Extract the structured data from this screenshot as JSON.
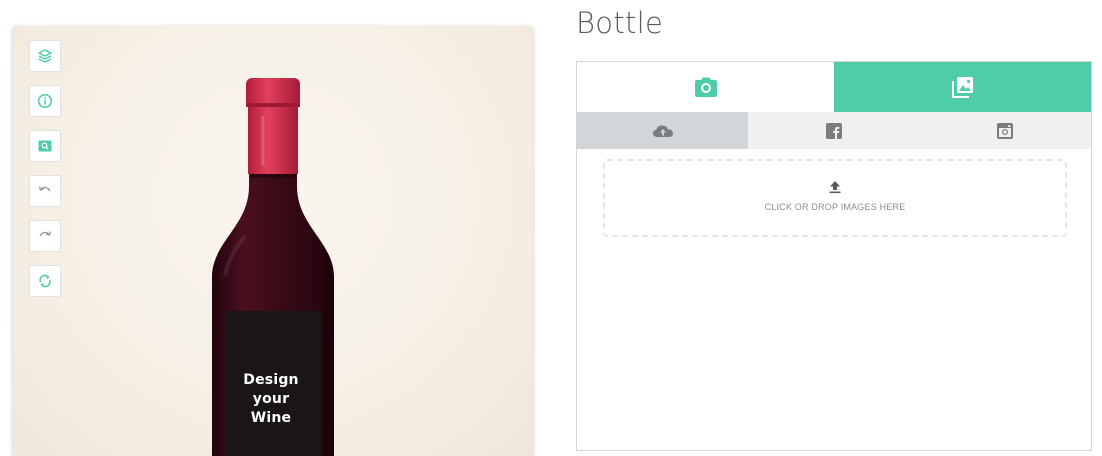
{
  "product": {
    "label_lines": [
      "Design",
      "your",
      "Wine"
    ],
    "bottle_capsule_color": "#d8324f",
    "bottle_glass_color": "#3c0a17"
  },
  "toolbar": {
    "items": [
      {
        "icon": "layers-icon",
        "name": "layers-button"
      },
      {
        "icon": "info-icon",
        "name": "info-button"
      },
      {
        "icon": "zoom-icon",
        "name": "zoom-button"
      },
      {
        "icon": "undo-icon",
        "name": "undo-button"
      },
      {
        "icon": "redo-icon",
        "name": "redo-button"
      },
      {
        "icon": "refresh-icon",
        "name": "refresh-button"
      }
    ]
  },
  "panel": {
    "title": "Bottle",
    "main_tabs": [
      {
        "icon": "camera-icon",
        "active": false
      },
      {
        "icon": "images-icon",
        "active": true
      }
    ],
    "sub_tabs": [
      {
        "icon": "cloud-upload-icon",
        "active": true
      },
      {
        "icon": "facebook-icon",
        "active": false
      },
      {
        "icon": "instagram-icon",
        "active": false
      }
    ],
    "dropzone": {
      "text": "CLICK OR DROP IMAGES HERE",
      "icon": "upload-icon"
    }
  },
  "colors": {
    "accent": "#4ecda8",
    "icon_gray": "#7a7d80",
    "tab_bg": "#eef0f1",
    "tab_active_bg": "#d3d6d8"
  }
}
